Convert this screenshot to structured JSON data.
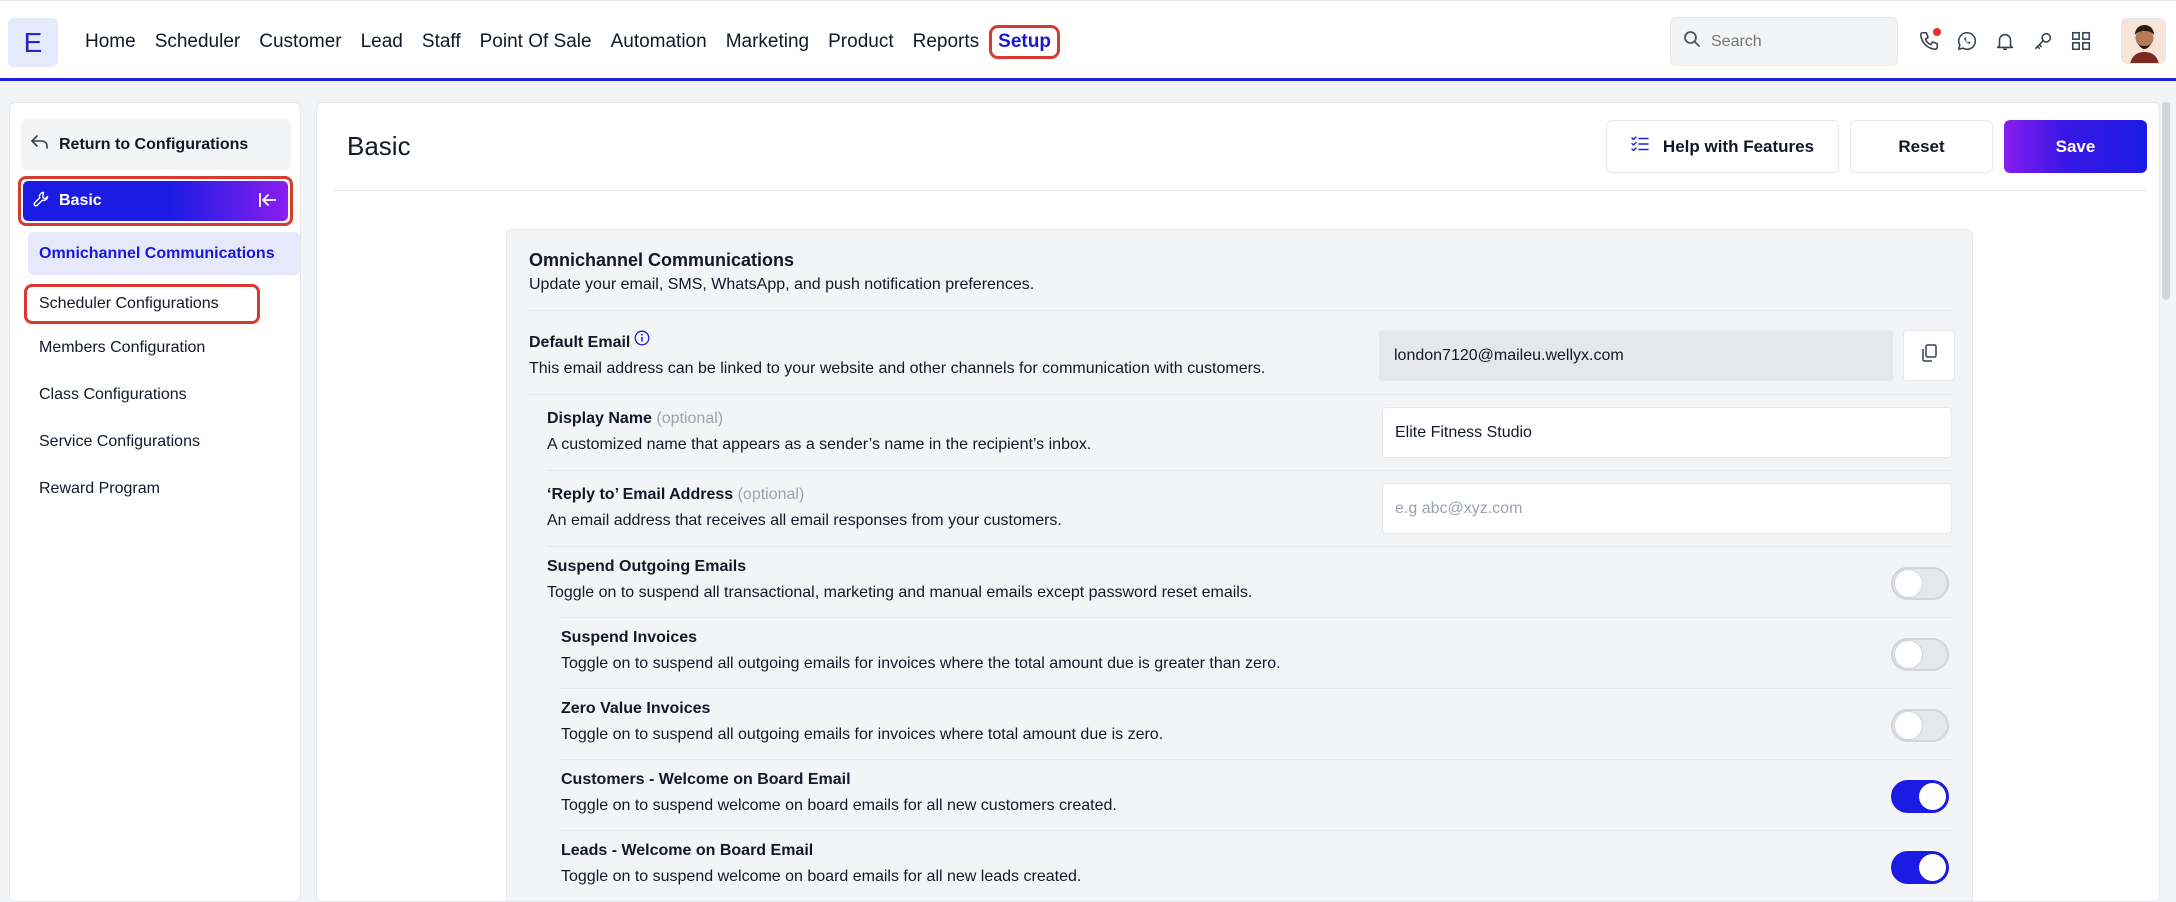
{
  "app": {
    "logo_letter": "E"
  },
  "nav": {
    "items": [
      {
        "label": "Home"
      },
      {
        "label": "Scheduler"
      },
      {
        "label": "Customer"
      },
      {
        "label": "Lead"
      },
      {
        "label": "Staff"
      },
      {
        "label": "Point Of Sale"
      },
      {
        "label": "Automation"
      },
      {
        "label": "Marketing"
      },
      {
        "label": "Product"
      },
      {
        "label": "Reports"
      },
      {
        "label": "Setup"
      }
    ],
    "active": "Setup"
  },
  "search": {
    "placeholder": "Search"
  },
  "topicons": [
    "phone-icon",
    "whatsapp-icon",
    "bell-icon",
    "key-icon",
    "apps-grid-icon"
  ],
  "sidebar": {
    "return_label": "Return to Configurations",
    "section_label": "Basic",
    "items": [
      {
        "label": "Omnichannel Communications",
        "selected": true
      },
      {
        "label": "Scheduler Configurations"
      },
      {
        "label": "Members Configuration"
      },
      {
        "label": "Class Configurations"
      },
      {
        "label": "Service Configurations"
      },
      {
        "label": "Reward Program"
      }
    ]
  },
  "header": {
    "title": "Basic",
    "help_label": "Help with Features",
    "reset_label": "Reset",
    "save_label": "Save"
  },
  "card": {
    "title": "Omnichannel Communications",
    "subtitle": "Update your email, SMS, WhatsApp, and push notification preferences.",
    "default_email": {
      "label": "Default Email",
      "desc": "This email address can be linked to your website and other channels for communication with customers.",
      "value": "london7120@maileu.wellyx.com"
    },
    "display_name": {
      "label": "Display Name",
      "optional": "(optional)",
      "desc": "A customized name that appears as a sender’s name in the recipient’s inbox.",
      "value": "Elite Fitness Studio"
    },
    "reply_to": {
      "label": "‘Reply to’ Email Address",
      "optional": "(optional)",
      "desc": "An email address that receives all email responses from your customers.",
      "placeholder": "e.g abc@xyz.com"
    },
    "toggles": [
      {
        "label": "Suspend Outgoing Emails",
        "desc": "Toggle on to suspend all transactional, marketing and manual emails except password reset emails.",
        "on": false
      },
      {
        "label": "Suspend Invoices",
        "desc": "Toggle on to suspend all outgoing emails for invoices where the total amount due is greater than zero.",
        "on": false
      },
      {
        "label": "Zero Value Invoices",
        "desc": "Toggle on to suspend all outgoing emails for invoices where total amount due is zero.",
        "on": false
      },
      {
        "label": "Customers - Welcome on Board Email",
        "desc": "Toggle on to suspend welcome on board emails for all new customers created.",
        "on": true
      },
      {
        "label": "Leads - Welcome on Board Email",
        "desc": "Toggle on to suspend welcome on board emails for all new leads created.",
        "on": true
      }
    ]
  },
  "colors": {
    "brand": "#1b1be3",
    "accent_gradient_end": "#8a1ef0",
    "highlight_outline": "#d93a2f"
  }
}
